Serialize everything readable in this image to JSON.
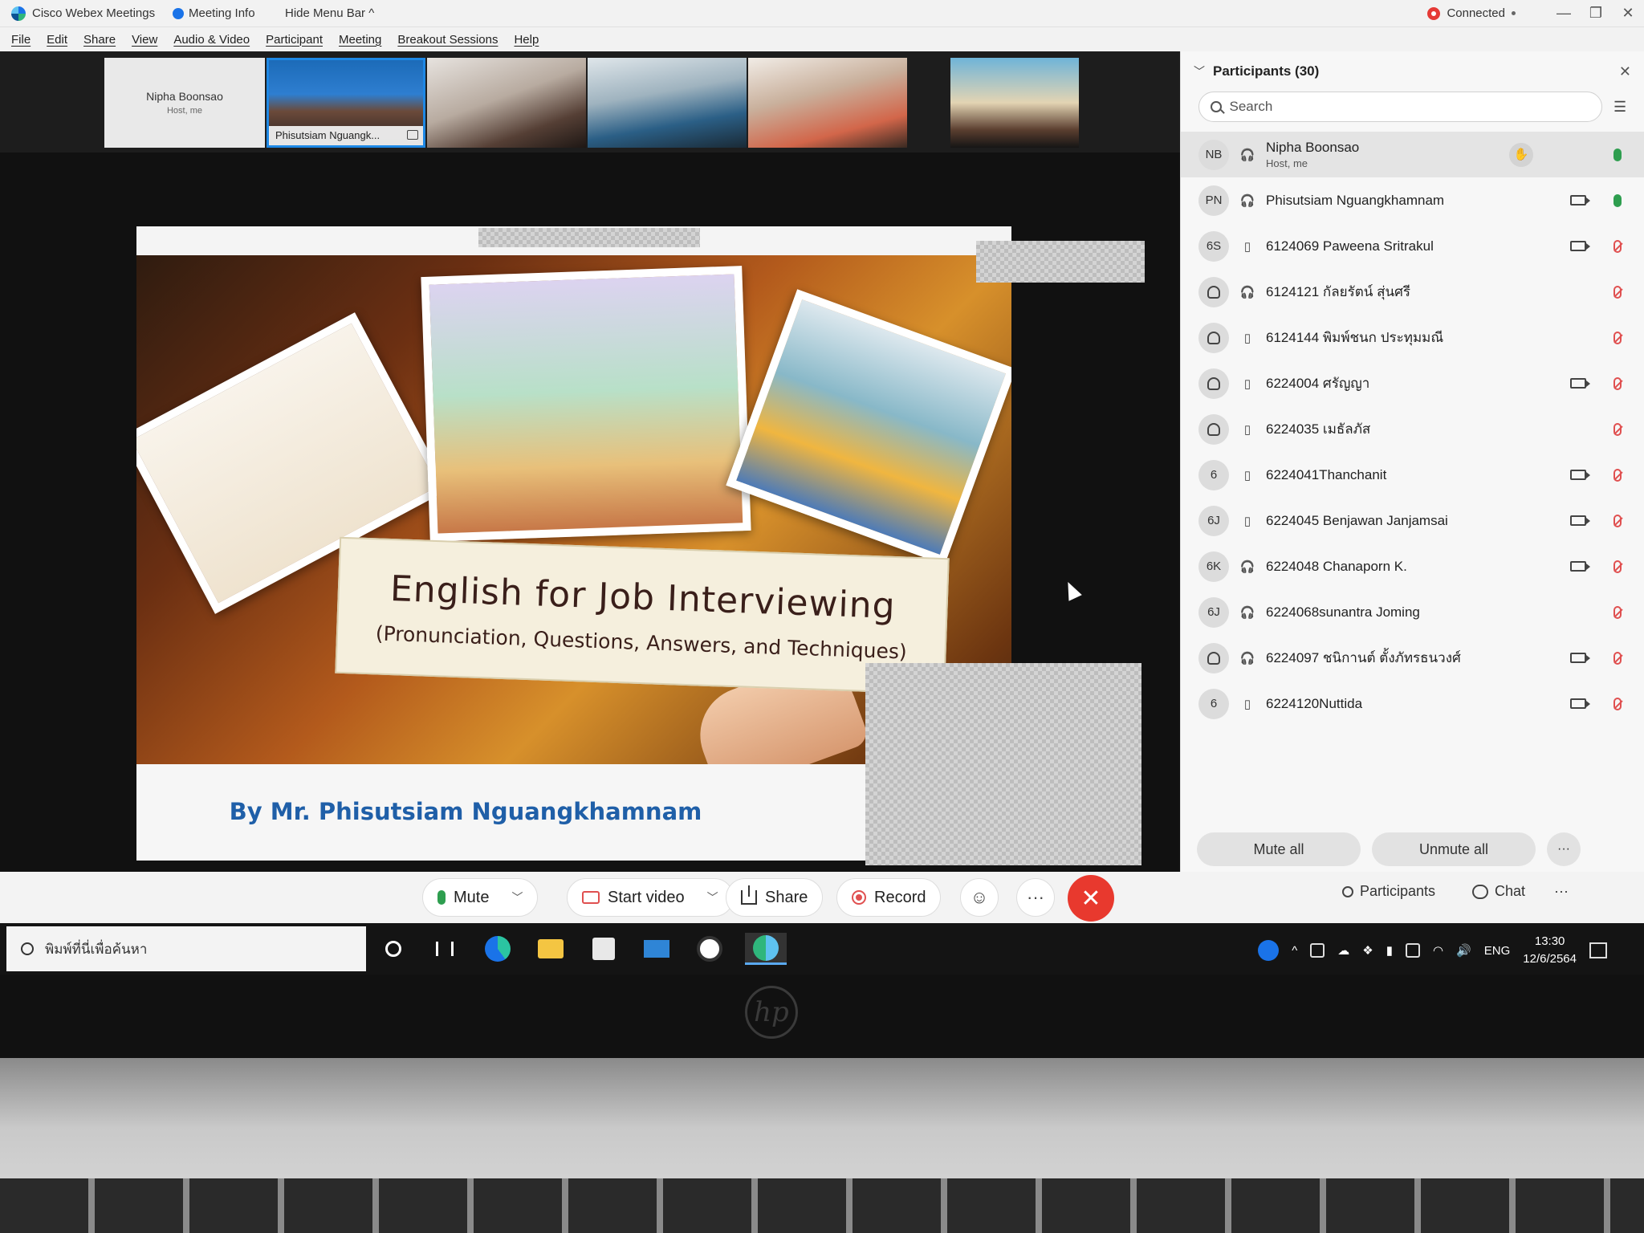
{
  "window": {
    "app_title": "Cisco Webex Meetings",
    "meeting_info": "Meeting Info",
    "hide_menu": "Hide Menu Bar ^",
    "status": "Connected",
    "controls": {
      "minimize": "—",
      "restore": "❐",
      "close": "✕"
    }
  },
  "menu": [
    "File",
    "Edit",
    "Share",
    "View",
    "Audio & Video",
    "Participant",
    "Meeting",
    "Breakout Sessions",
    "Help"
  ],
  "thumbnails": {
    "host": {
      "name": "Nipha Boonsao",
      "role": "Host, me"
    },
    "presenter_label": "Phisutsiam Nguangk..."
  },
  "slide": {
    "title": "English for Job Interviewing",
    "subtitle": "(Pronunciation, Questions, Answers, and Techniques)",
    "byline": "By Mr. Phisutsiam Nguangkhamnam"
  },
  "participants_panel": {
    "title": "Participants (30)",
    "search_placeholder": "Search",
    "mute_all": "Mute all",
    "unmute_all": "Unmute all",
    "more": "···",
    "rows": [
      {
        "initials": "NB",
        "name": "Nipha Boonsao",
        "sub": "Host, me",
        "conn": "headset",
        "video": false,
        "mic": "on",
        "hand": true
      },
      {
        "initials": "PN",
        "name": "Phisutsiam Nguangkhamnam",
        "conn": "headset",
        "video": true,
        "mic": "on"
      },
      {
        "initials": "6S",
        "name": "6124069 Paweena Sritrakul",
        "conn": "phone",
        "video": true,
        "mic": "off"
      },
      {
        "initials": "",
        "name": "6124121 กัลยรัตน์ สุ่นศรี",
        "conn": "headset",
        "video": false,
        "mic": "off"
      },
      {
        "initials": "",
        "name": "6124144 พิมพ์ชนก ประทุมมณี",
        "conn": "phone",
        "video": false,
        "mic": "off"
      },
      {
        "initials": "",
        "name": "6224004 ศรัญญา",
        "conn": "phone",
        "video": true,
        "mic": "off"
      },
      {
        "initials": "",
        "name": "6224035 เมธัลภัส",
        "conn": "phone",
        "video": false,
        "mic": "off"
      },
      {
        "initials": "6",
        "name": "6224041Thanchanit",
        "conn": "phone",
        "video": true,
        "mic": "off"
      },
      {
        "initials": "6J",
        "name": "6224045 Benjawan Janjamsai",
        "conn": "phone",
        "video": true,
        "mic": "off"
      },
      {
        "initials": "6K",
        "name": "6224048 Chanaporn K.",
        "conn": "headset",
        "video": true,
        "mic": "off"
      },
      {
        "initials": "6J",
        "name": "6224068sunantra Joming",
        "conn": "headset",
        "video": false,
        "mic": "off"
      },
      {
        "initials": "",
        "name": "6224097 ชนิกานต์ ตั้งภัทรธนวงศ์",
        "conn": "headset",
        "video": true,
        "mic": "off"
      },
      {
        "initials": "6",
        "name": "6224120Nuttida",
        "conn": "phone",
        "video": true,
        "mic": "off"
      }
    ]
  },
  "meeting_controls": {
    "mute": "Mute",
    "start_video": "Start video",
    "share": "Share",
    "record": "Record",
    "reactions": "☺",
    "more": "···",
    "end": "✕",
    "participants": "Participants",
    "chat": "Chat",
    "overflow": "···"
  },
  "taskbar": {
    "search_placeholder": "พิมพ์ที่นี่เพื่อค้นหา",
    "language": "ENG",
    "time": "13:30",
    "date": "12/6/2564"
  },
  "colors": {
    "accent": "#1a73e8",
    "end_call": "#e8392e",
    "mic_on": "#2e9e4f",
    "mic_off": "#e05050",
    "byline": "#1f5fa8"
  }
}
